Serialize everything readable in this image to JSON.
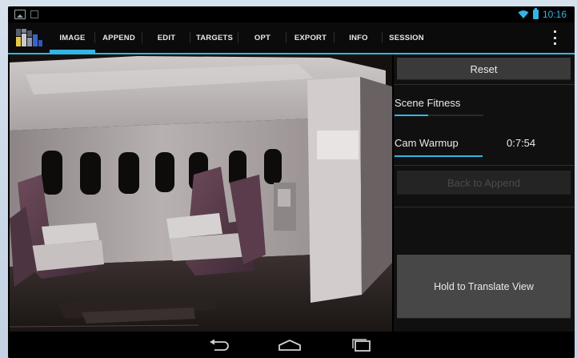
{
  "status_bar": {
    "time": "10:16",
    "icons": [
      "gallery-icon",
      "notification-square-icon",
      "wifi-icon",
      "battery-icon"
    ],
    "accent": "#33b5e5"
  },
  "action_bar": {
    "logo": "app-logo-icon",
    "tabs": [
      {
        "label": "IMAGE",
        "active": true
      },
      {
        "label": "APPEND",
        "active": false
      },
      {
        "label": "EDIT",
        "active": false
      },
      {
        "label": "TARGETS",
        "active": false
      },
      {
        "label": "OPT",
        "active": false
      },
      {
        "label": "EXPORT",
        "active": false
      },
      {
        "label": "INFO",
        "active": false
      },
      {
        "label": "SESSION",
        "active": false
      }
    ],
    "overflow": "overflow-menu-icon"
  },
  "viewport": {
    "content": "3d-scan-aircraft-cabin-image"
  },
  "panel": {
    "reset_label": "Reset",
    "scene_fitness_label": "Scene Fitness",
    "scene_fitness_progress": 0.38,
    "cam_warmup_label": "Cam Warmup",
    "cam_warmup_time": "0:7:54",
    "cam_warmup_progress": 1.0,
    "back_to_append_label": "Back to Append",
    "back_to_append_enabled": false,
    "hold_translate_label": "Hold to Translate View"
  },
  "nav_bar": {
    "icons": [
      "back-icon",
      "home-icon",
      "recent-apps-icon"
    ]
  },
  "colors": {
    "accent": "#33b5e5",
    "button": "#3a3a3a",
    "background": "#101010"
  }
}
